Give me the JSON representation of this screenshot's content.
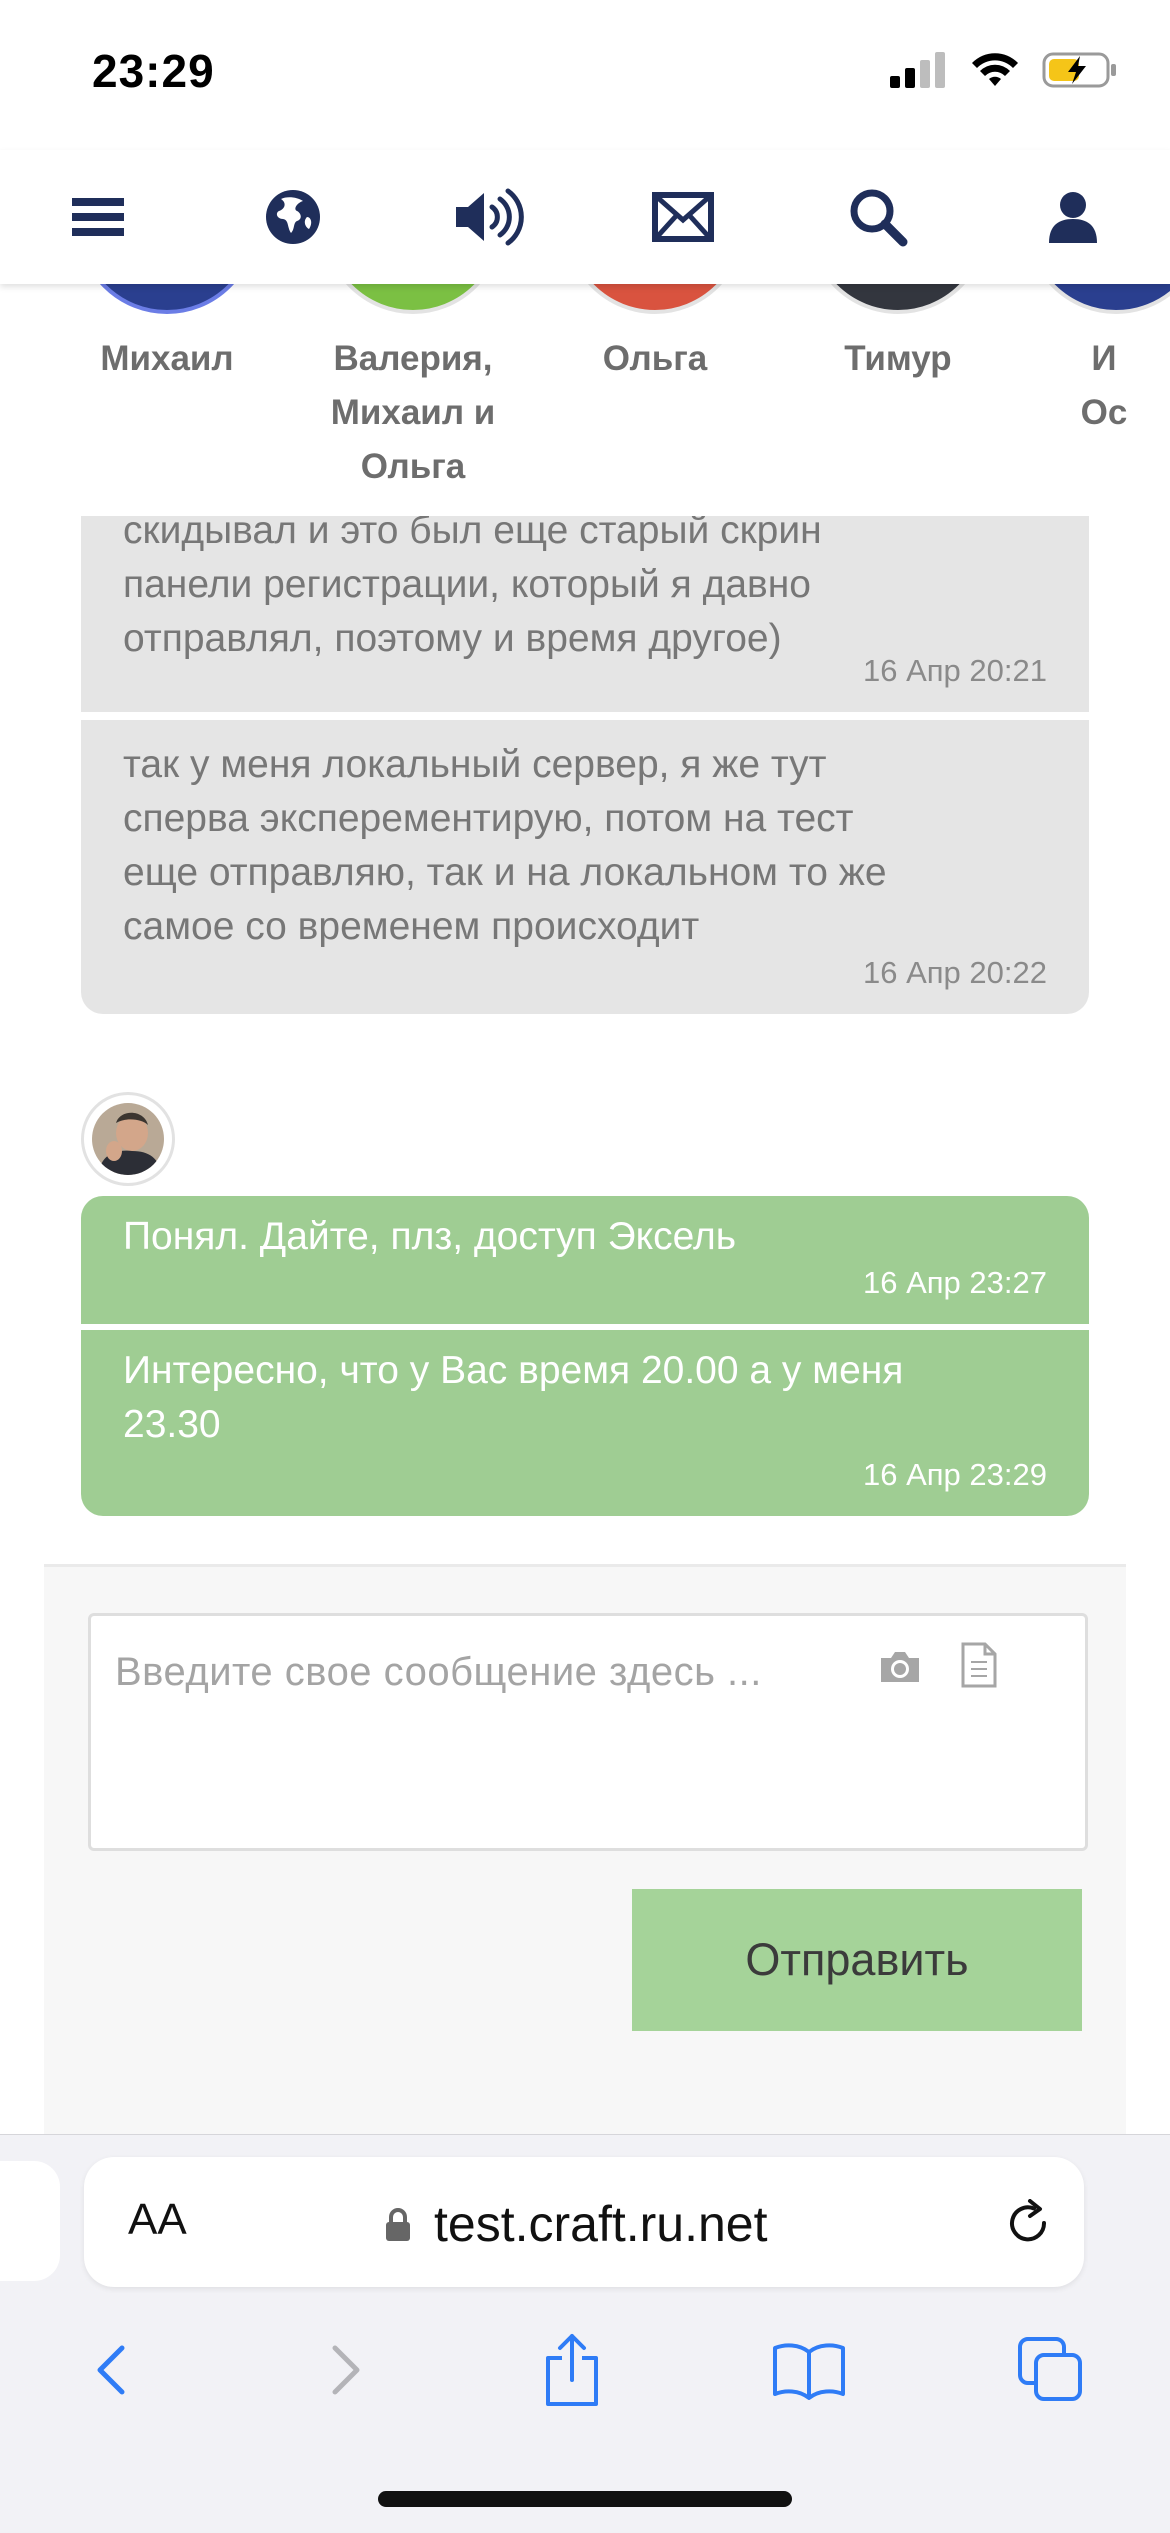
{
  "status_bar": {
    "time": "23:29"
  },
  "top_nav": {
    "icons": [
      "menu-icon",
      "globe-icon",
      "speaker-icon",
      "mail-icon",
      "search-icon",
      "user-icon"
    ]
  },
  "contacts": [
    {
      "name": "Михаил"
    },
    {
      "name": "Валерия, Михаил и Ольга"
    },
    {
      "name": "Ольга"
    },
    {
      "name": "Тимур"
    },
    {
      "name": "И\nОс"
    }
  ],
  "messages": [
    {
      "from": "other",
      "text_lines": [
        "скидывал и это был еще старый скрин",
        "панели регистрации, который я давно",
        "отправлял, поэтому и время другое)"
      ],
      "time": "16 Апр 20:21"
    },
    {
      "from": "other",
      "text_lines": [
        "так у меня локальный сервер, я же тут",
        "сперва эксперементирую, потом на тест",
        "еще отправляю, так и на локальном то же",
        "самое со временем происходит"
      ],
      "time": "16 Апр 20:22"
    },
    {
      "from": "me",
      "text_lines": [
        "Понял. Дайте, плз, доступ Эксель"
      ],
      "time": "16 Апр 23:27"
    },
    {
      "from": "me",
      "text_lines": [
        "Интересно, что у Вас время 20.00 а у меня",
        "23.30"
      ],
      "time": "16 Апр 23:29"
    }
  ],
  "compose": {
    "placeholder": "Введите свое сообщение здесь ...",
    "send_label": "Отправить"
  },
  "browser": {
    "aa_label": "AA",
    "url": "test.craft.ru.net"
  },
  "colors": {
    "brand_navy": "#1f2e5a",
    "incoming_bubble": "#e5e5e5",
    "outgoing_bubble": "#9fcd93",
    "send_button": "#a5d399",
    "ios_blue": "#2f7cf6"
  }
}
